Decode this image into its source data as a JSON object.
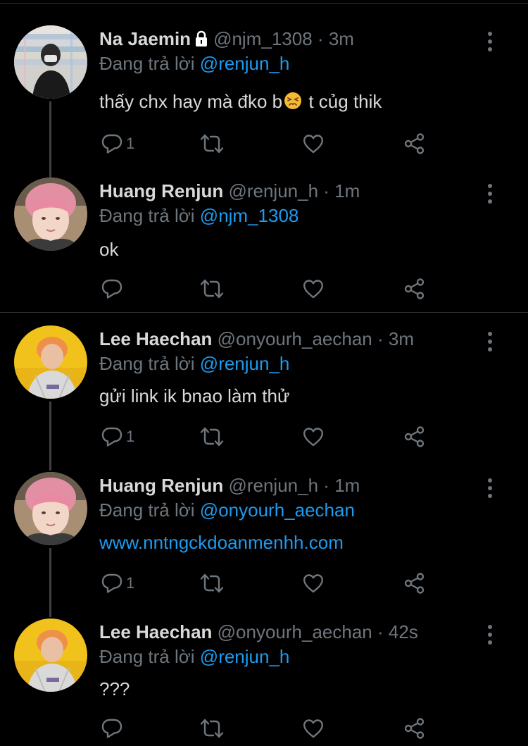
{
  "reply_prefix": "Đang trả lời",
  "tweets": [
    {
      "name": "Na Jaemin",
      "handle": "@njm_1308",
      "dot": "·",
      "time": "3m",
      "reply_to": "@renjun_h",
      "text_before": "thấy chx hay mà đko b",
      "emoji_icon": "persevering-face-icon",
      "text_after": " t củg thik",
      "reply_count": "1",
      "protected": true
    },
    {
      "name": "Huang Renjun",
      "handle": "@renjun_h",
      "dot": "·",
      "time": "1m",
      "reply_to": "@njm_1308",
      "text": "ok",
      "reply_count": ""
    },
    {
      "name": "Lee Haechan",
      "handle": "@onyourh_aechan",
      "dot": "·",
      "time": "3m",
      "reply_to": "@renjun_h",
      "text": "gửi link ik bnao làm thử",
      "reply_count": "1"
    },
    {
      "name": "Huang Renjun",
      "handle": "@renjun_h",
      "dot": "·",
      "time": "1m",
      "reply_to": "@onyourh_aechan",
      "link": "www.nntngckdoanmenhh.com",
      "reply_count": "1"
    },
    {
      "name": "Lee Haechan",
      "handle": "@onyourh_aechan",
      "dot": "·",
      "time": "42s",
      "reply_to": "@renjun_h",
      "text": "???",
      "reply_count": ""
    }
  ],
  "colors": {
    "background": "#000000",
    "text": "#d9d9d9",
    "muted": "#6e767d",
    "accent": "#1d9bf0",
    "divider": "#2f3336"
  }
}
